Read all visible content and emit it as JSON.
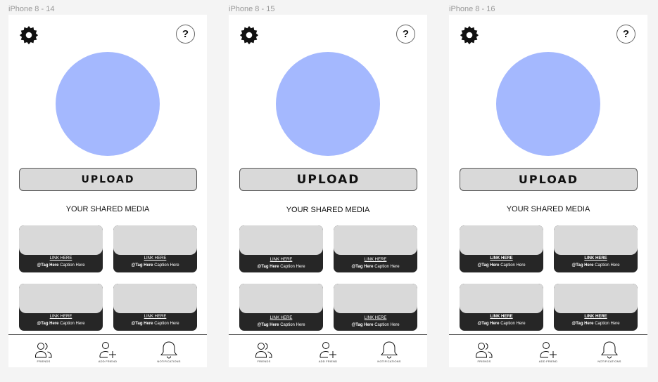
{
  "frames": [
    {
      "label": "iPhone 8 - 14"
    },
    {
      "label": "iPhone 8 - 15"
    },
    {
      "label": "iPhone 8 - 16"
    }
  ],
  "help_symbol": "?",
  "upload_label": "UPLOAD",
  "section_title": "YOUR SHARED MEDIA",
  "card": {
    "link": "LINK HERE",
    "tag": "@Tag Here",
    "caption": "Caption Here"
  },
  "nav": {
    "friends": "FRIENDS",
    "add_friend": "ADD FRIEND",
    "notifications": "NOTIFICATIONS"
  },
  "icons": {
    "settings": "gear-icon",
    "help": "question-icon",
    "friends": "people-icon",
    "add_friend": "person-plus-icon",
    "notifications": "bell-icon"
  },
  "colors": {
    "avatar": "#a4b8fe",
    "upload_bg": "#d9d9d9",
    "card_footer": "#262626",
    "page_bg": "#f4f4f4"
  }
}
